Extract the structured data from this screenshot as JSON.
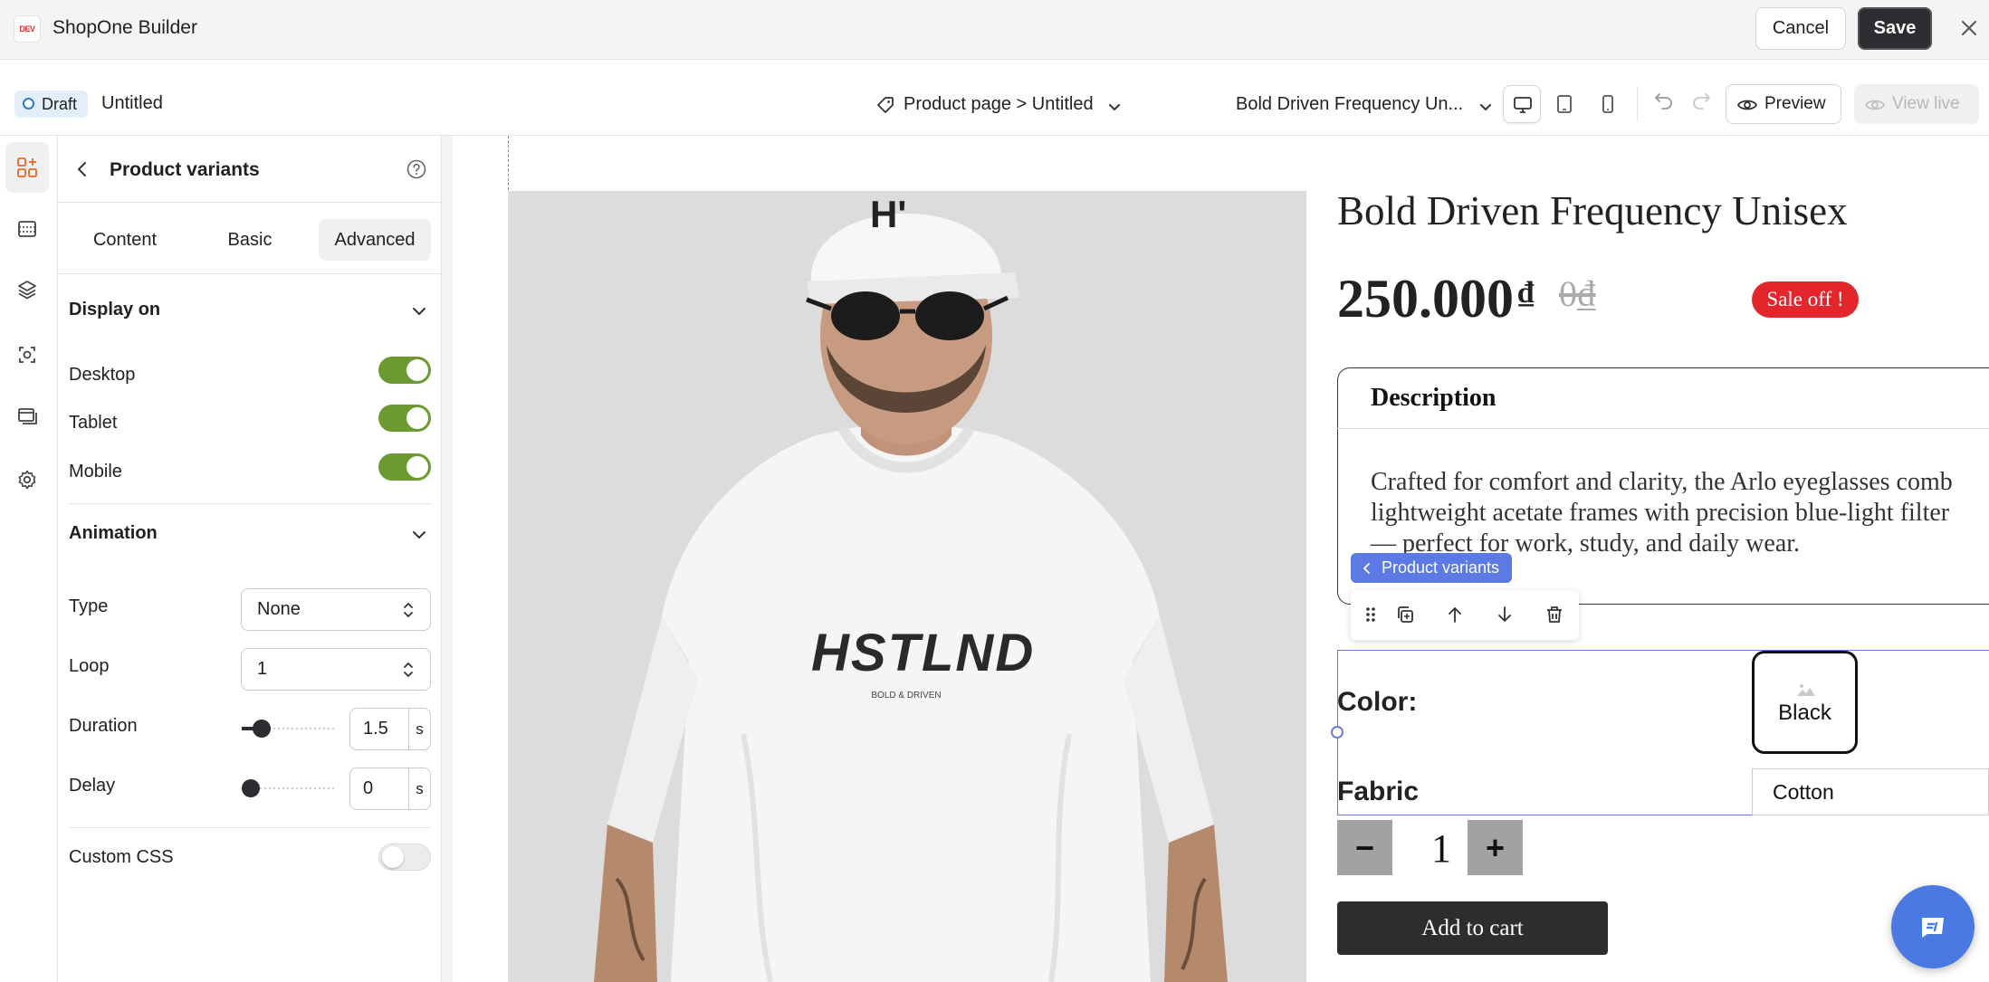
{
  "app": {
    "title": "ShopOne Builder",
    "logo_text": "DEV",
    "cancel_label": "Cancel",
    "save_label": "Save"
  },
  "toolbar": {
    "status_badge": "Draft",
    "page_name": "Untitled",
    "breadcrumb": "Product page > Untitled",
    "product_select": "Bold Driven Frequency Un...",
    "preview_label": "Preview",
    "view_live_label": "View live",
    "active_device": "desktop"
  },
  "rail": {
    "items": [
      "elements-icon",
      "sections-icon",
      "layers-icon",
      "theme-icon",
      "pages-icon",
      "settings-icon"
    ],
    "active": "elements-icon"
  },
  "panel": {
    "title": "Product variants",
    "tabs": [
      {
        "label": "Content"
      },
      {
        "label": "Basic"
      },
      {
        "label": "Advanced"
      }
    ],
    "active_tab": "Advanced",
    "display_on": {
      "title": "Display on",
      "desktop_label": "Desktop",
      "desktop_on": true,
      "tablet_label": "Tablet",
      "tablet_on": true,
      "mobile_label": "Mobile",
      "mobile_on": true
    },
    "animation": {
      "title": "Animation",
      "type_label": "Type",
      "type_value": "None",
      "loop_label": "Loop",
      "loop_value": "1",
      "duration_label": "Duration",
      "duration_value": "1.5",
      "duration_unit": "s",
      "delay_label": "Delay",
      "delay_value": "0",
      "delay_unit": "s"
    },
    "custom_css": {
      "label": "Custom CSS",
      "on": false
    }
  },
  "canvas": {
    "product_name": "Bold Driven Frequency Unisex",
    "price": "250.000",
    "currency": "₫",
    "old_price": "0₫",
    "sale_badge": "Sale off !",
    "description_title": "Description",
    "description_lines": [
      "Crafted for comfort and clarity, the Arlo eyeglasses comb",
      "lightweight acetate frames with precision blue-light filter",
      "— perfect for work, study, and daily wear."
    ],
    "selected_element_label": "Product variants",
    "color_label": "Color:",
    "color_value": "Black",
    "fabric_label": "Fabric",
    "fabric_value": "Cotton",
    "qty_minus": "−",
    "qty_value": "1",
    "qty_plus": "+",
    "add_to_cart": "Add to cart",
    "tshirt_print": "HSTLND",
    "tshirt_sub": "BOLD & DRIVEN"
  },
  "colors": {
    "toggle_on": "#6c9a31",
    "selection": "#5b7ae4",
    "sale": "#e3262c",
    "chat": "#4a79e2"
  }
}
